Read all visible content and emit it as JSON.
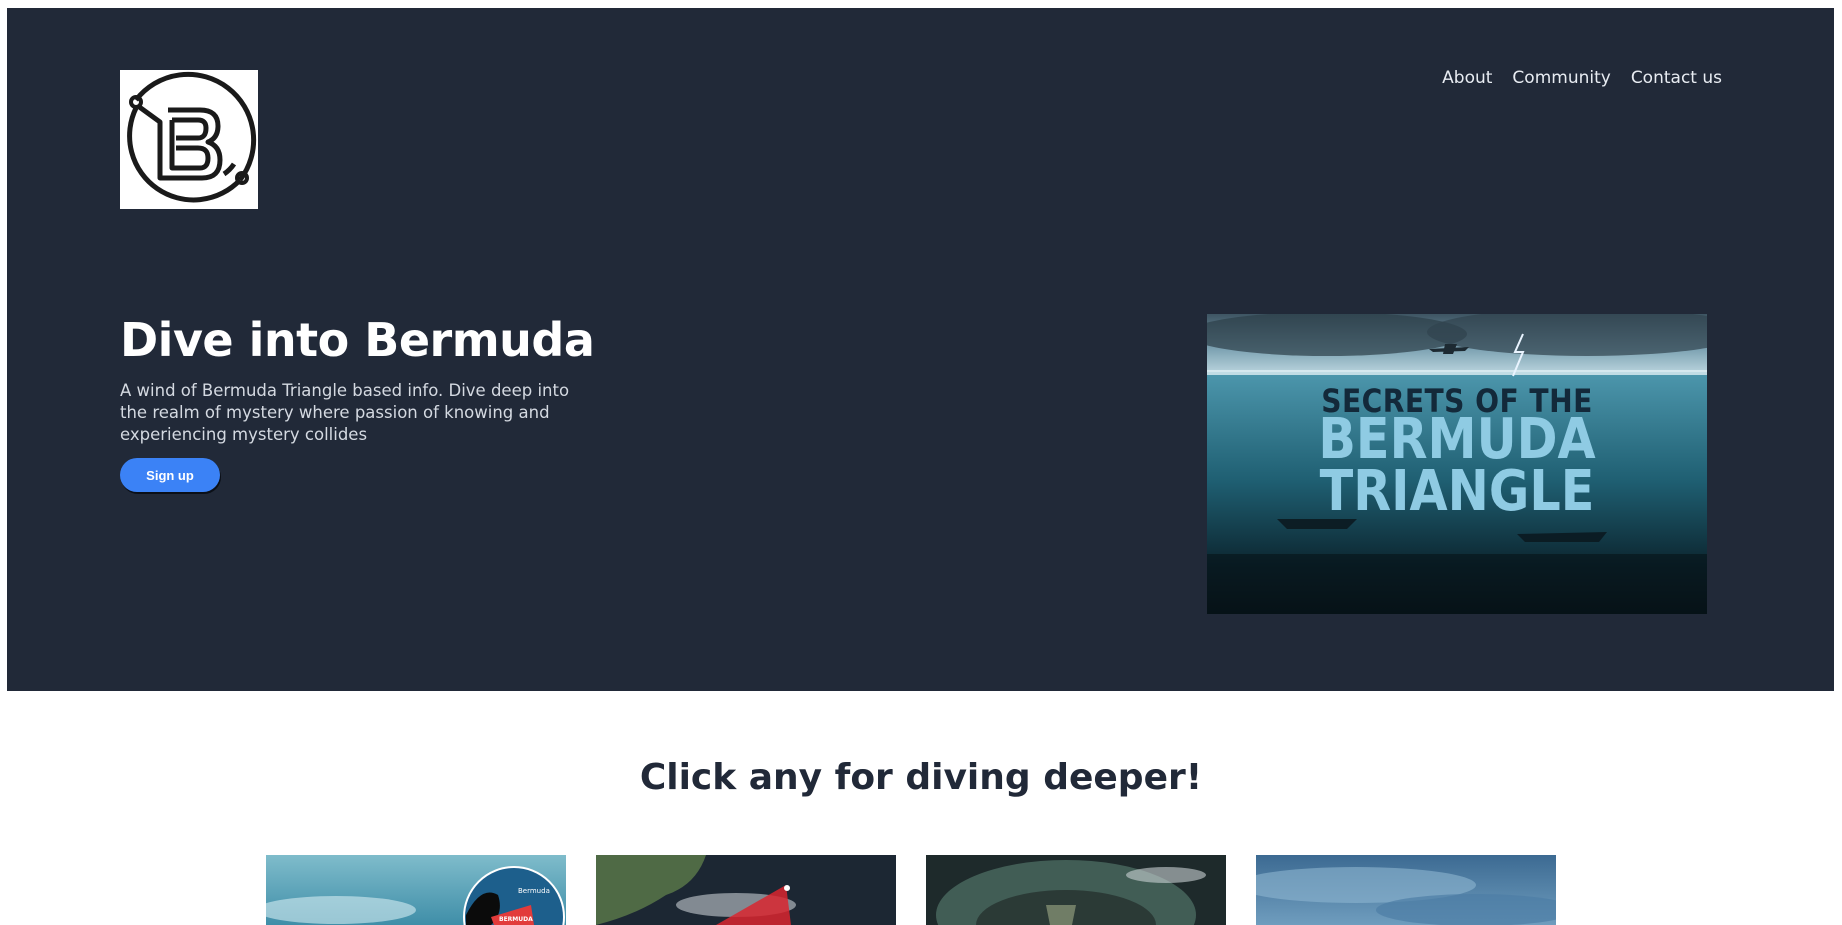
{
  "nav": {
    "items": [
      "About",
      "Community",
      "Contact us"
    ]
  },
  "hero": {
    "title": "Dive into Bermuda",
    "description": "A wind of Bermuda Triangle based info. Dive deep into the realm of mystery where passion of knowing and experiencing mystery collides",
    "signup_label": "Sign up"
  },
  "poster": {
    "line1": "SECRETS OF THE",
    "line2": "BERMUDA",
    "line3": "TRIANGLE"
  },
  "section": {
    "title": "Click any for diving deeper!"
  },
  "cards": {
    "map_label": "Bermuda",
    "map_badge": "BERMUDA"
  },
  "colors": {
    "hero_bg": "#212938",
    "accent": "#3b82f6",
    "title_dark": "#212938"
  }
}
